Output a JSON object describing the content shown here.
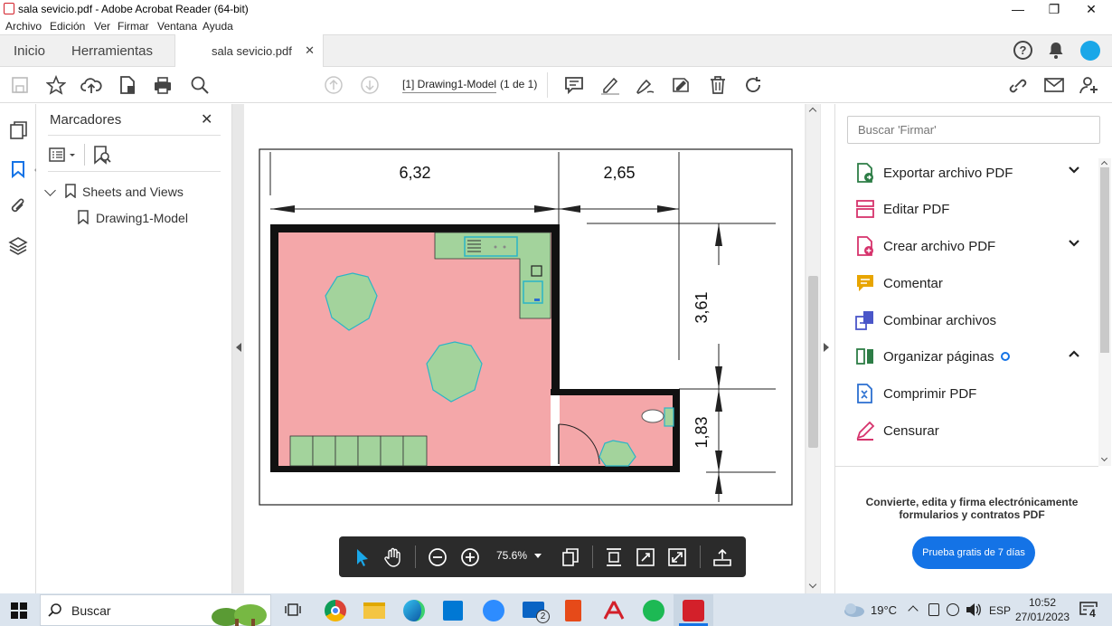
{
  "window": {
    "title": "sala sevicio.pdf - Adobe Acrobat Reader (64-bit)"
  },
  "menu": [
    "Archivo",
    "Edición",
    "Ver",
    "Firmar",
    "Ventana",
    "Ayuda"
  ],
  "tabs": {
    "home": "Inicio",
    "tools": "Herramientas",
    "document": "sala sevicio.pdf"
  },
  "toolbar": {
    "page_label": "[1] Drawing1-Model",
    "page_count": "(1 de 1)"
  },
  "bookmarks": {
    "title": "Marcadores",
    "tree": [
      {
        "label": "Sheets and Views",
        "children": [
          {
            "label": "Drawing1-Model"
          }
        ]
      }
    ]
  },
  "drawing": {
    "dimensions": [
      "6,32",
      "2,65",
      "3,61",
      "1,83"
    ]
  },
  "right_panel": {
    "search_placeholder": "Buscar 'Firmar'",
    "tools": [
      {
        "label": "Exportar archivo PDF",
        "icon": "export-pdf-icon",
        "color": "#2d7d46",
        "chevron": "down"
      },
      {
        "label": "Editar PDF",
        "icon": "edit-pdf-icon",
        "color": "#d6336c",
        "chevron": ""
      },
      {
        "label": "Crear archivo PDF",
        "icon": "create-pdf-icon",
        "color": "#d6336c",
        "chevron": "down"
      },
      {
        "label": "Comentar",
        "icon": "comment-icon",
        "color": "#e8a500",
        "chevron": ""
      },
      {
        "label": "Combinar archivos",
        "icon": "combine-icon",
        "color": "#4a56c9",
        "chevron": ""
      },
      {
        "label": "Organizar páginas",
        "icon": "organize-icon",
        "color": "#2d7d46",
        "chevron": "up",
        "badge": true
      },
      {
        "label": "Comprimir PDF",
        "icon": "compress-icon",
        "color": "#2b6fd0",
        "chevron": ""
      },
      {
        "label": "Censurar",
        "icon": "redact-icon",
        "color": "#d6336c",
        "chevron": ""
      }
    ],
    "promo_text": "Convierte, edita y firma electrónicamente formularios y contratos PDF",
    "promo_button": "Prueba gratis de 7 días"
  },
  "float_toolbar": {
    "zoom": "75.6%"
  },
  "taskbar": {
    "search": "Buscar",
    "weather": "19°C",
    "lang": "ESP",
    "time": "10:52",
    "date": "27/01/2023",
    "mail_badge": "2",
    "notif_badge": "4"
  },
  "colors": {
    "accent": "#1473e6",
    "room_floor": "#f4a7a9",
    "furniture": "#a3d39c",
    "taskbar": "#dbe4ee"
  }
}
